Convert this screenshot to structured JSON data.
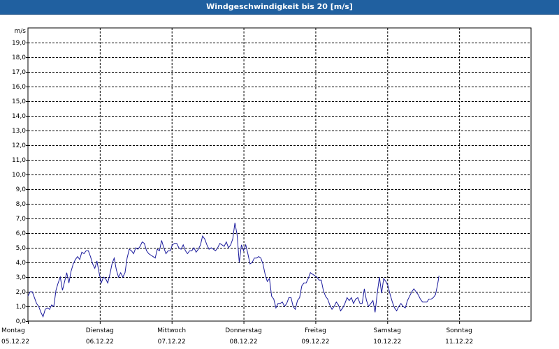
{
  "window": {
    "title": "Windgeschwindigkeit bis 20 [m/s]"
  },
  "chart_data": {
    "type": "line",
    "title": "Windgeschwindigkeit bis 20 [m/s]",
    "ylabel": "m/s",
    "ylim": [
      0,
      20
    ],
    "y_ticks": [
      "0,0",
      "1,0",
      "2,0",
      "3,0",
      "4,0",
      "5,0",
      "6,0",
      "7,0",
      "8,0",
      "9,0",
      "10,0",
      "11,0",
      "12,0",
      "13,0",
      "14,0",
      "15,0",
      "16,0",
      "17,0",
      "18,0",
      "19,0"
    ],
    "x_range_days": [
      0,
      7
    ],
    "days": [
      {
        "weekday": "Montag",
        "date": "05.12.22"
      },
      {
        "weekday": "Dienstag",
        "date": "06.12.22"
      },
      {
        "weekday": "Mittwoch",
        "date": "07.12.22"
      },
      {
        "weekday": "Donnerstag",
        "date": "08.12.22"
      },
      {
        "weekday": "Freitag",
        "date": "09.12.22"
      },
      {
        "weekday": "Samstag",
        "date": "10.12.22"
      },
      {
        "weekday": "Sonntag",
        "date": "11.12.22"
      }
    ],
    "grid": true,
    "line_color": "#1a1a9c",
    "series": [
      {
        "name": "",
        "points": [
          [
            0.0,
            1.7
          ],
          [
            0.03,
            2.0
          ],
          [
            0.06,
            2.0
          ],
          [
            0.09,
            1.6
          ],
          [
            0.12,
            1.2
          ],
          [
            0.15,
            1.0
          ],
          [
            0.18,
            0.6
          ],
          [
            0.21,
            0.3
          ],
          [
            0.24,
            0.8
          ],
          [
            0.27,
            0.9
          ],
          [
            0.3,
            0.8
          ],
          [
            0.33,
            1.1
          ],
          [
            0.36,
            1.0
          ],
          [
            0.39,
            2.1
          ],
          [
            0.42,
            2.6
          ],
          [
            0.45,
            3.0
          ],
          [
            0.48,
            2.1
          ],
          [
            0.51,
            2.7
          ],
          [
            0.54,
            3.3
          ],
          [
            0.57,
            2.6
          ],
          [
            0.6,
            3.4
          ],
          [
            0.63,
            3.9
          ],
          [
            0.66,
            4.2
          ],
          [
            0.69,
            4.4
          ],
          [
            0.72,
            4.2
          ],
          [
            0.75,
            4.7
          ],
          [
            0.78,
            4.6
          ],
          [
            0.81,
            4.8
          ],
          [
            0.84,
            4.8
          ],
          [
            0.87,
            4.4
          ],
          [
            0.9,
            3.9
          ],
          [
            0.93,
            3.6
          ],
          [
            0.96,
            4.1
          ],
          [
            0.99,
            3.3
          ],
          [
            1.02,
            2.6
          ],
          [
            1.05,
            3.0
          ],
          [
            1.08,
            2.9
          ],
          [
            1.11,
            2.6
          ],
          [
            1.14,
            3.2
          ],
          [
            1.17,
            3.9
          ],
          [
            1.2,
            4.3
          ],
          [
            1.23,
            3.5
          ],
          [
            1.26,
            3.0
          ],
          [
            1.29,
            3.3
          ],
          [
            1.32,
            3.0
          ],
          [
            1.35,
            3.3
          ],
          [
            1.38,
            4.3
          ],
          [
            1.41,
            4.9
          ],
          [
            1.44,
            4.8
          ],
          [
            1.47,
            4.6
          ],
          [
            1.5,
            5.0
          ],
          [
            1.53,
            4.9
          ],
          [
            1.56,
            5.1
          ],
          [
            1.59,
            5.4
          ],
          [
            1.62,
            5.3
          ],
          [
            1.65,
            4.8
          ],
          [
            1.68,
            4.6
          ],
          [
            1.71,
            4.5
          ],
          [
            1.74,
            4.4
          ],
          [
            1.77,
            4.3
          ],
          [
            1.8,
            4.9
          ],
          [
            1.83,
            4.8
          ],
          [
            1.86,
            5.5
          ],
          [
            1.89,
            5.0
          ],
          [
            1.92,
            4.6
          ],
          [
            1.95,
            4.8
          ],
          [
            1.98,
            4.8
          ],
          [
            2.01,
            5.2
          ],
          [
            2.04,
            5.3
          ],
          [
            2.07,
            5.3
          ],
          [
            2.1,
            5.0
          ],
          [
            2.13,
            4.9
          ],
          [
            2.16,
            5.2
          ],
          [
            2.19,
            4.8
          ],
          [
            2.22,
            4.6
          ],
          [
            2.25,
            4.8
          ],
          [
            2.28,
            4.8
          ],
          [
            2.31,
            5.0
          ],
          [
            2.34,
            4.7
          ],
          [
            2.37,
            4.9
          ],
          [
            2.4,
            5.2
          ],
          [
            2.43,
            5.8
          ],
          [
            2.46,
            5.6
          ],
          [
            2.49,
            5.2
          ],
          [
            2.52,
            4.9
          ],
          [
            2.55,
            5.0
          ],
          [
            2.58,
            4.9
          ],
          [
            2.61,
            4.8
          ],
          [
            2.64,
            5.0
          ],
          [
            2.67,
            5.3
          ],
          [
            2.7,
            5.2
          ],
          [
            2.73,
            5.1
          ],
          [
            2.76,
            5.4
          ],
          [
            2.79,
            5.0
          ],
          [
            2.82,
            5.2
          ],
          [
            2.85,
            5.6
          ],
          [
            2.88,
            6.7
          ],
          [
            2.91,
            5.9
          ],
          [
            2.94,
            4.0
          ],
          [
            2.97,
            5.2
          ],
          [
            3.0,
            4.8
          ],
          [
            3.03,
            5.2
          ],
          [
            3.06,
            4.6
          ],
          [
            3.09,
            3.9
          ],
          [
            3.12,
            4.0
          ],
          [
            3.15,
            4.3
          ],
          [
            3.18,
            4.3
          ],
          [
            3.21,
            4.4
          ],
          [
            3.24,
            4.3
          ],
          [
            3.27,
            3.9
          ],
          [
            3.3,
            3.2
          ],
          [
            3.33,
            2.7
          ],
          [
            3.36,
            2.9
          ],
          [
            3.39,
            1.7
          ],
          [
            3.42,
            1.5
          ],
          [
            3.45,
            0.9
          ],
          [
            3.48,
            1.2
          ],
          [
            3.51,
            1.2
          ],
          [
            3.54,
            1.3
          ],
          [
            3.57,
            1.0
          ],
          [
            3.6,
            1.2
          ],
          [
            3.63,
            1.6
          ],
          [
            3.66,
            1.6
          ],
          [
            3.69,
            1.0
          ],
          [
            3.72,
            0.8
          ],
          [
            3.75,
            1.4
          ],
          [
            3.78,
            1.6
          ],
          [
            3.81,
            2.4
          ],
          [
            3.84,
            2.6
          ],
          [
            3.87,
            2.6
          ],
          [
            3.9,
            2.9
          ],
          [
            3.93,
            3.3
          ],
          [
            3.96,
            3.2
          ],
          [
            3.99,
            3.1
          ],
          [
            4.02,
            3.0
          ],
          [
            4.05,
            2.8
          ],
          [
            4.08,
            2.8
          ],
          [
            4.11,
            2.1
          ],
          [
            4.14,
            1.7
          ],
          [
            4.17,
            1.5
          ],
          [
            4.2,
            1.1
          ],
          [
            4.23,
            0.8
          ],
          [
            4.26,
            1.0
          ],
          [
            4.29,
            1.3
          ],
          [
            4.32,
            1.1
          ],
          [
            4.35,
            0.7
          ],
          [
            4.38,
            0.9
          ],
          [
            4.41,
            1.2
          ],
          [
            4.44,
            1.6
          ],
          [
            4.47,
            1.4
          ],
          [
            4.5,
            1.6
          ],
          [
            4.53,
            1.2
          ],
          [
            4.56,
            1.5
          ],
          [
            4.59,
            1.6
          ],
          [
            4.62,
            1.2
          ],
          [
            4.65,
            1.2
          ],
          [
            4.68,
            2.2
          ],
          [
            4.71,
            1.4
          ],
          [
            4.74,
            1.0
          ],
          [
            4.77,
            1.2
          ],
          [
            4.8,
            1.4
          ],
          [
            4.83,
            0.6
          ],
          [
            4.86,
            1.9
          ],
          [
            4.89,
            3.0
          ],
          [
            4.92,
            1.9
          ],
          [
            4.95,
            2.9
          ],
          [
            4.98,
            2.7
          ],
          [
            5.01,
            2.4
          ],
          [
            5.04,
            1.8
          ],
          [
            5.07,
            1.3
          ],
          [
            5.1,
            0.9
          ],
          [
            5.13,
            0.7
          ],
          [
            5.16,
            1.0
          ],
          [
            5.19,
            1.2
          ],
          [
            5.22,
            1.0
          ],
          [
            5.25,
            0.9
          ],
          [
            5.28,
            1.4
          ],
          [
            5.31,
            1.7
          ],
          [
            5.34,
            2.0
          ],
          [
            5.37,
            2.2
          ],
          [
            5.4,
            2.0
          ],
          [
            5.43,
            1.8
          ],
          [
            5.46,
            1.5
          ],
          [
            5.49,
            1.3
          ],
          [
            5.52,
            1.3
          ],
          [
            5.55,
            1.3
          ],
          [
            5.58,
            1.5
          ],
          [
            5.61,
            1.5
          ],
          [
            5.64,
            1.6
          ],
          [
            5.67,
            1.8
          ],
          [
            5.7,
            2.5
          ],
          [
            5.72,
            3.1
          ]
        ]
      }
    ]
  }
}
